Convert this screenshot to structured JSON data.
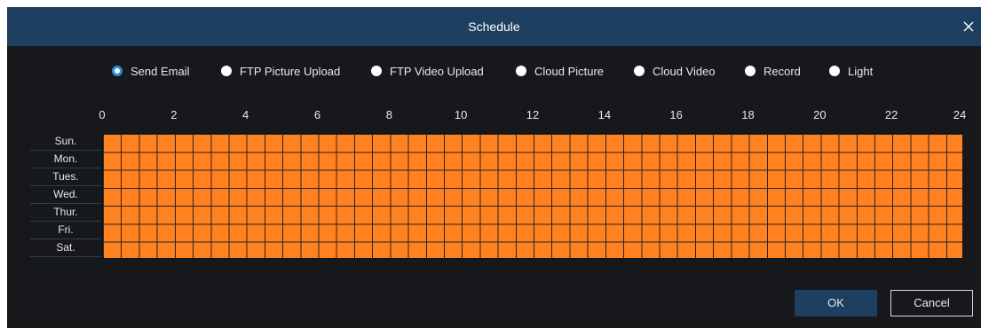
{
  "dialog": {
    "title": "Schedule",
    "close_icon": "close-icon",
    "ok_label": "OK",
    "cancel_label": "Cancel"
  },
  "actions": [
    {
      "label": "Send Email",
      "selected": true
    },
    {
      "label": "FTP Picture Upload",
      "selected": false
    },
    {
      "label": "FTP Video Upload",
      "selected": false
    },
    {
      "label": "Cloud Picture",
      "selected": false
    },
    {
      "label": "Cloud Video",
      "selected": false
    },
    {
      "label": "Record",
      "selected": false
    },
    {
      "label": "Light",
      "selected": false
    }
  ],
  "schedule": {
    "hour_labels": [
      "0",
      "2",
      "4",
      "6",
      "8",
      "10",
      "12",
      "14",
      "16",
      "18",
      "20",
      "22",
      "24"
    ],
    "days": [
      "Sun.",
      "Mon.",
      "Tues.",
      "Wed.",
      "Thur.",
      "Fri.",
      "Sat."
    ],
    "slots_per_day": 48,
    "all_slots_active": true
  },
  "colors": {
    "title_bar": "#1d3f60",
    "background": "#16181c",
    "active_slot": "#ff8120",
    "radio_selected": "#2e8ee0"
  }
}
